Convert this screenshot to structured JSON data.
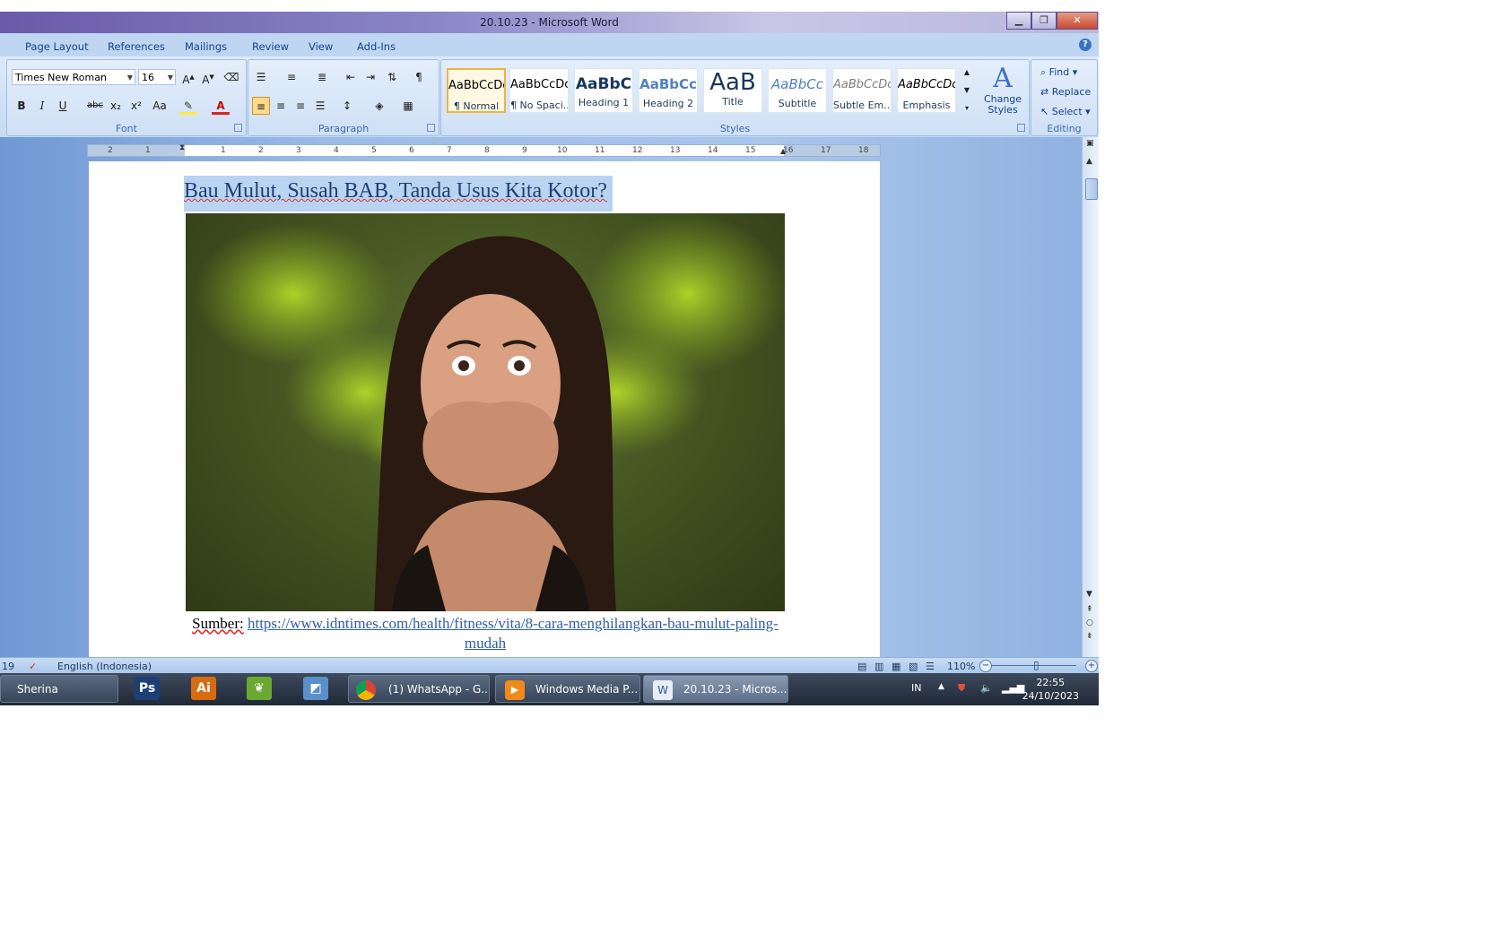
{
  "window": {
    "title": "20.10.23 - Microsoft Word",
    "min": "▁",
    "max": "❐",
    "close": "✕"
  },
  "ribbon": {
    "tabs": [
      "Page Layout",
      "References",
      "Mailings",
      "Review",
      "View",
      "Add-Ins"
    ],
    "help": "?",
    "font": {
      "name": "Times New Roman",
      "size": "16",
      "label": "Font"
    },
    "paragraph": {
      "label": "Paragraph"
    },
    "styles": {
      "label": "Styles",
      "items": [
        {
          "preview": "AaBbCcDc",
          "name": "¶ Normal"
        },
        {
          "preview": "AaBbCcDc",
          "name": "¶ No Spaci..."
        },
        {
          "preview": "AaBbC",
          "name": "Heading 1"
        },
        {
          "preview": "AaBbCc",
          "name": "Heading 2"
        },
        {
          "preview": "AaB",
          "name": "Title"
        },
        {
          "preview": "AaBbCc",
          "name": "Subtitle"
        },
        {
          "preview": "AaBbCcDc",
          "name": "Subtle Em..."
        },
        {
          "preview": "AaBbCcDc",
          "name": "Emphasis"
        }
      ],
      "change": "Change Styles"
    },
    "editing": {
      "label": "Editing",
      "find": "Find",
      "replace": "Replace",
      "select": "Select"
    }
  },
  "ruler": [
    "2",
    "1",
    "1",
    "2",
    "3",
    "4",
    "5",
    "6",
    "7",
    "8",
    "9",
    "10",
    "11",
    "12",
    "13",
    "14",
    "15",
    "16",
    "17",
    "18"
  ],
  "document": {
    "title": "Bau Mulut, Susah BAB, Tanda Usus Kita Kotor?",
    "source_label": "Sumber:",
    "source_link": "https://www.idntimes.com/health/fitness/vita/8-cara-menghilangkan-bau-mulut-paling-mudah"
  },
  "statusbar": {
    "page": "19",
    "language": "English (Indonesia)",
    "zoom": "110%"
  },
  "taskbar": {
    "user": "Sherina",
    "apps": [
      {
        "icon": "Ps",
        "color": "#1c3f77"
      },
      {
        "icon": "Ai",
        "color": "#d86a10"
      }
    ],
    "windows": [
      "(1) WhatsApp - G...",
      "Windows Media P...",
      "20.10.23 - Micros..."
    ],
    "lang": "IN",
    "time": "22:55",
    "date": "24/10/2023"
  }
}
